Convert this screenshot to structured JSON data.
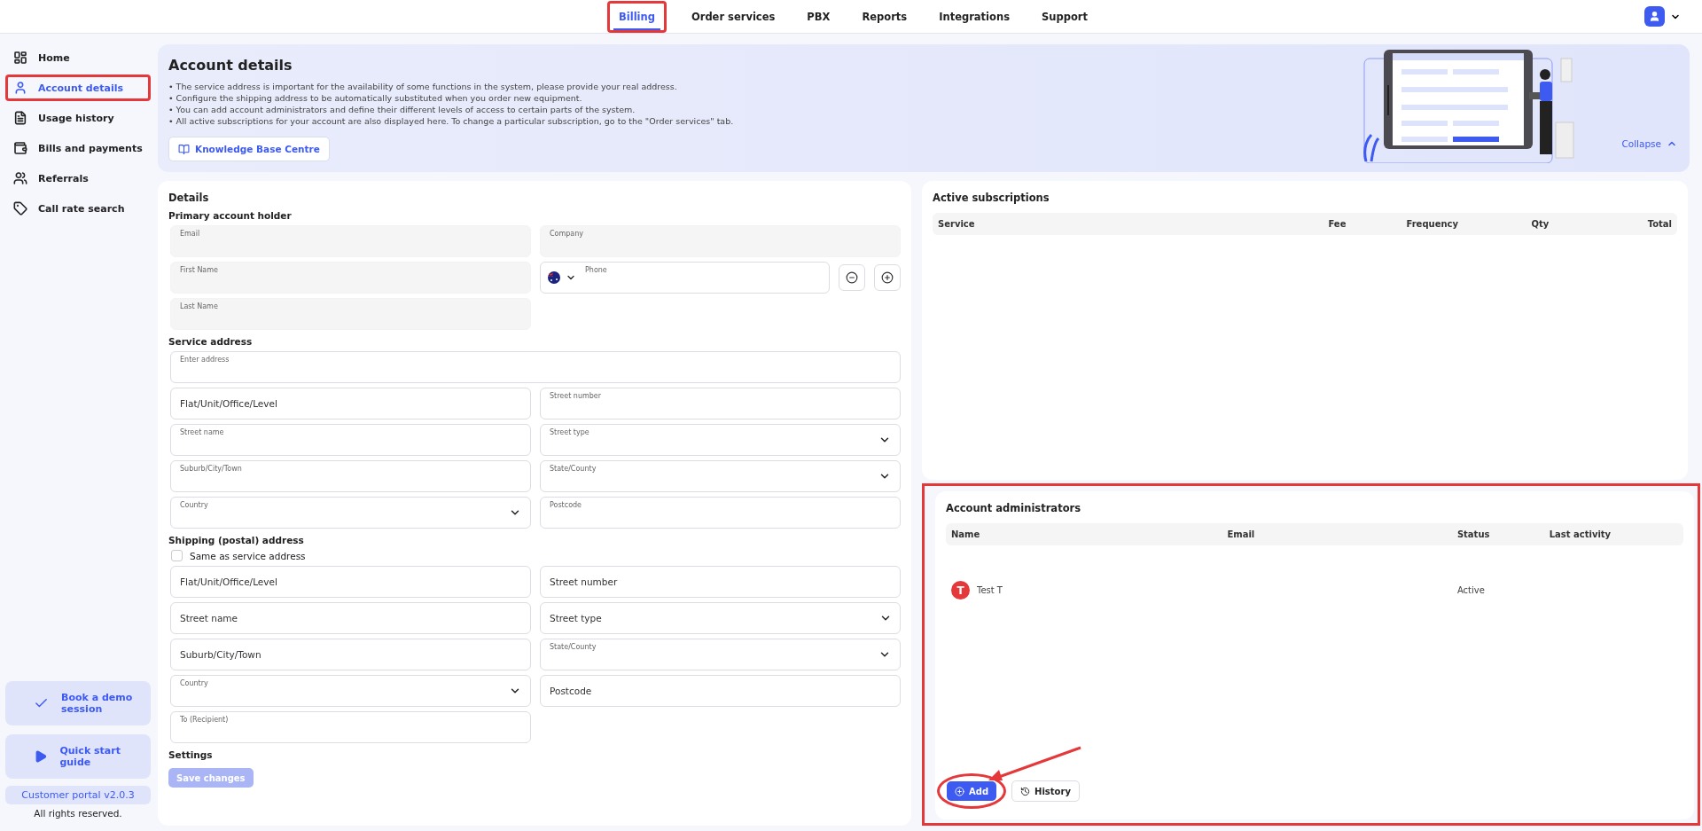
{
  "nav": {
    "tabs": [
      {
        "label": "Billing",
        "selected": true,
        "highlighted": true
      },
      {
        "label": "Order services",
        "selected": false,
        "highlighted": false
      },
      {
        "label": "PBX",
        "selected": false,
        "highlighted": false
      },
      {
        "label": "Reports",
        "selected": false,
        "highlighted": false
      },
      {
        "label": "Integrations",
        "selected": false,
        "highlighted": false
      },
      {
        "label": "Support",
        "selected": false,
        "highlighted": false
      }
    ]
  },
  "sidebar": {
    "items": [
      {
        "label": "Home",
        "selected": false,
        "highlighted": false
      },
      {
        "label": "Account details",
        "selected": true,
        "highlighted": true
      },
      {
        "label": "Usage history",
        "selected": false,
        "highlighted": false
      },
      {
        "label": "Bills and payments",
        "selected": false,
        "highlighted": false
      },
      {
        "label": "Referrals",
        "selected": false,
        "highlighted": false
      },
      {
        "label": "Call rate search",
        "selected": false,
        "highlighted": false
      }
    ],
    "promos": [
      {
        "label": "Book a demo session"
      },
      {
        "label": "Quick start guide"
      }
    ],
    "version": "Customer portal v2.0.3",
    "rights": "All rights reserved."
  },
  "banner": {
    "title": "Account details",
    "bullets": [
      "• The service address is important for the availability of some functions in the system, please provide your real address.",
      "• Configure the shipping address to be automatically substituted when you order new equipment.",
      "• You can add account administrators and define their different levels of access to certain parts of the system.",
      "• All active subscriptions for your account are also displayed here. To change a particular subscription, go to the \"Order services\" tab."
    ],
    "button": "Knowledge Base Centre",
    "collapse": "Collapse"
  },
  "details": {
    "title": "Details",
    "sections": [
      {
        "heading": "Primary account holder",
        "rows": [
          [
            {
              "kind": "text",
              "label": "Email",
              "disabled": true
            },
            {
              "kind": "text",
              "label": "Company",
              "disabled": true
            }
          ],
          [
            {
              "kind": "text",
              "label": "First Name",
              "disabled": true
            },
            {
              "kind": "phone",
              "label": "Phone",
              "disabled": false
            }
          ],
          [
            {
              "kind": "text",
              "label": "Last Name",
              "disabled": true
            }
          ]
        ]
      },
      {
        "heading": "Service address",
        "rows": [
          [
            {
              "kind": "text",
              "label": "Enter address",
              "disabled": false,
              "wide": true
            }
          ],
          [
            {
              "kind": "text",
              "placeholder": "Flat/Unit/Office/Level",
              "disabled": false
            },
            {
              "kind": "text",
              "label": "Street number",
              "disabled": false
            }
          ],
          [
            {
              "kind": "text",
              "label": "Street name",
              "disabled": false
            },
            {
              "kind": "select",
              "label": "Street type",
              "disabled": false
            }
          ],
          [
            {
              "kind": "text",
              "label": "Suburb/City/Town",
              "disabled": false
            },
            {
              "kind": "select",
              "label": "State/County",
              "disabled": false
            }
          ],
          [
            {
              "kind": "select",
              "label": "Country",
              "disabled": false
            },
            {
              "kind": "text",
              "label": "Postcode",
              "disabled": false
            }
          ]
        ]
      },
      {
        "heading": "Shipping (postal) address",
        "checkbox": {
          "label": "Same as service address",
          "checked": false
        },
        "rows": [
          [
            {
              "kind": "text",
              "placeholder": "Flat/Unit/Office/Level",
              "disabled": false
            },
            {
              "kind": "text",
              "placeholder": "Street number",
              "disabled": false
            }
          ],
          [
            {
              "kind": "text",
              "placeholder": "Street name",
              "disabled": false
            },
            {
              "kind": "select",
              "placeholder": "Street type",
              "disabled": false
            }
          ],
          [
            {
              "kind": "text",
              "placeholder": "Suburb/City/Town",
              "disabled": false
            },
            {
              "kind": "select",
              "label": "State/County",
              "disabled": false
            }
          ],
          [
            {
              "kind": "select",
              "label": "Country",
              "disabled": false
            },
            {
              "kind": "text",
              "placeholder": "Postcode",
              "disabled": false
            }
          ],
          [
            {
              "kind": "text",
              "label": "To (Recipient)",
              "disabled": false
            }
          ]
        ]
      },
      {
        "heading": "Settings"
      }
    ],
    "save": {
      "label": "Save changes",
      "disabled": true
    }
  },
  "subscriptions": {
    "title": "Active subscriptions",
    "columns": [
      "Service",
      "Fee",
      "Frequency",
      "Qty",
      "Total"
    ]
  },
  "administrators": {
    "title": "Account administrators",
    "highlighted": true,
    "columns": [
      "Name",
      "Email",
      "Status",
      "Last activity"
    ],
    "rows": [
      {
        "initial": "T",
        "name": "Test T",
        "status": "Active"
      }
    ],
    "add": {
      "label": "Add",
      "highlighted": true
    },
    "history": "History"
  }
}
